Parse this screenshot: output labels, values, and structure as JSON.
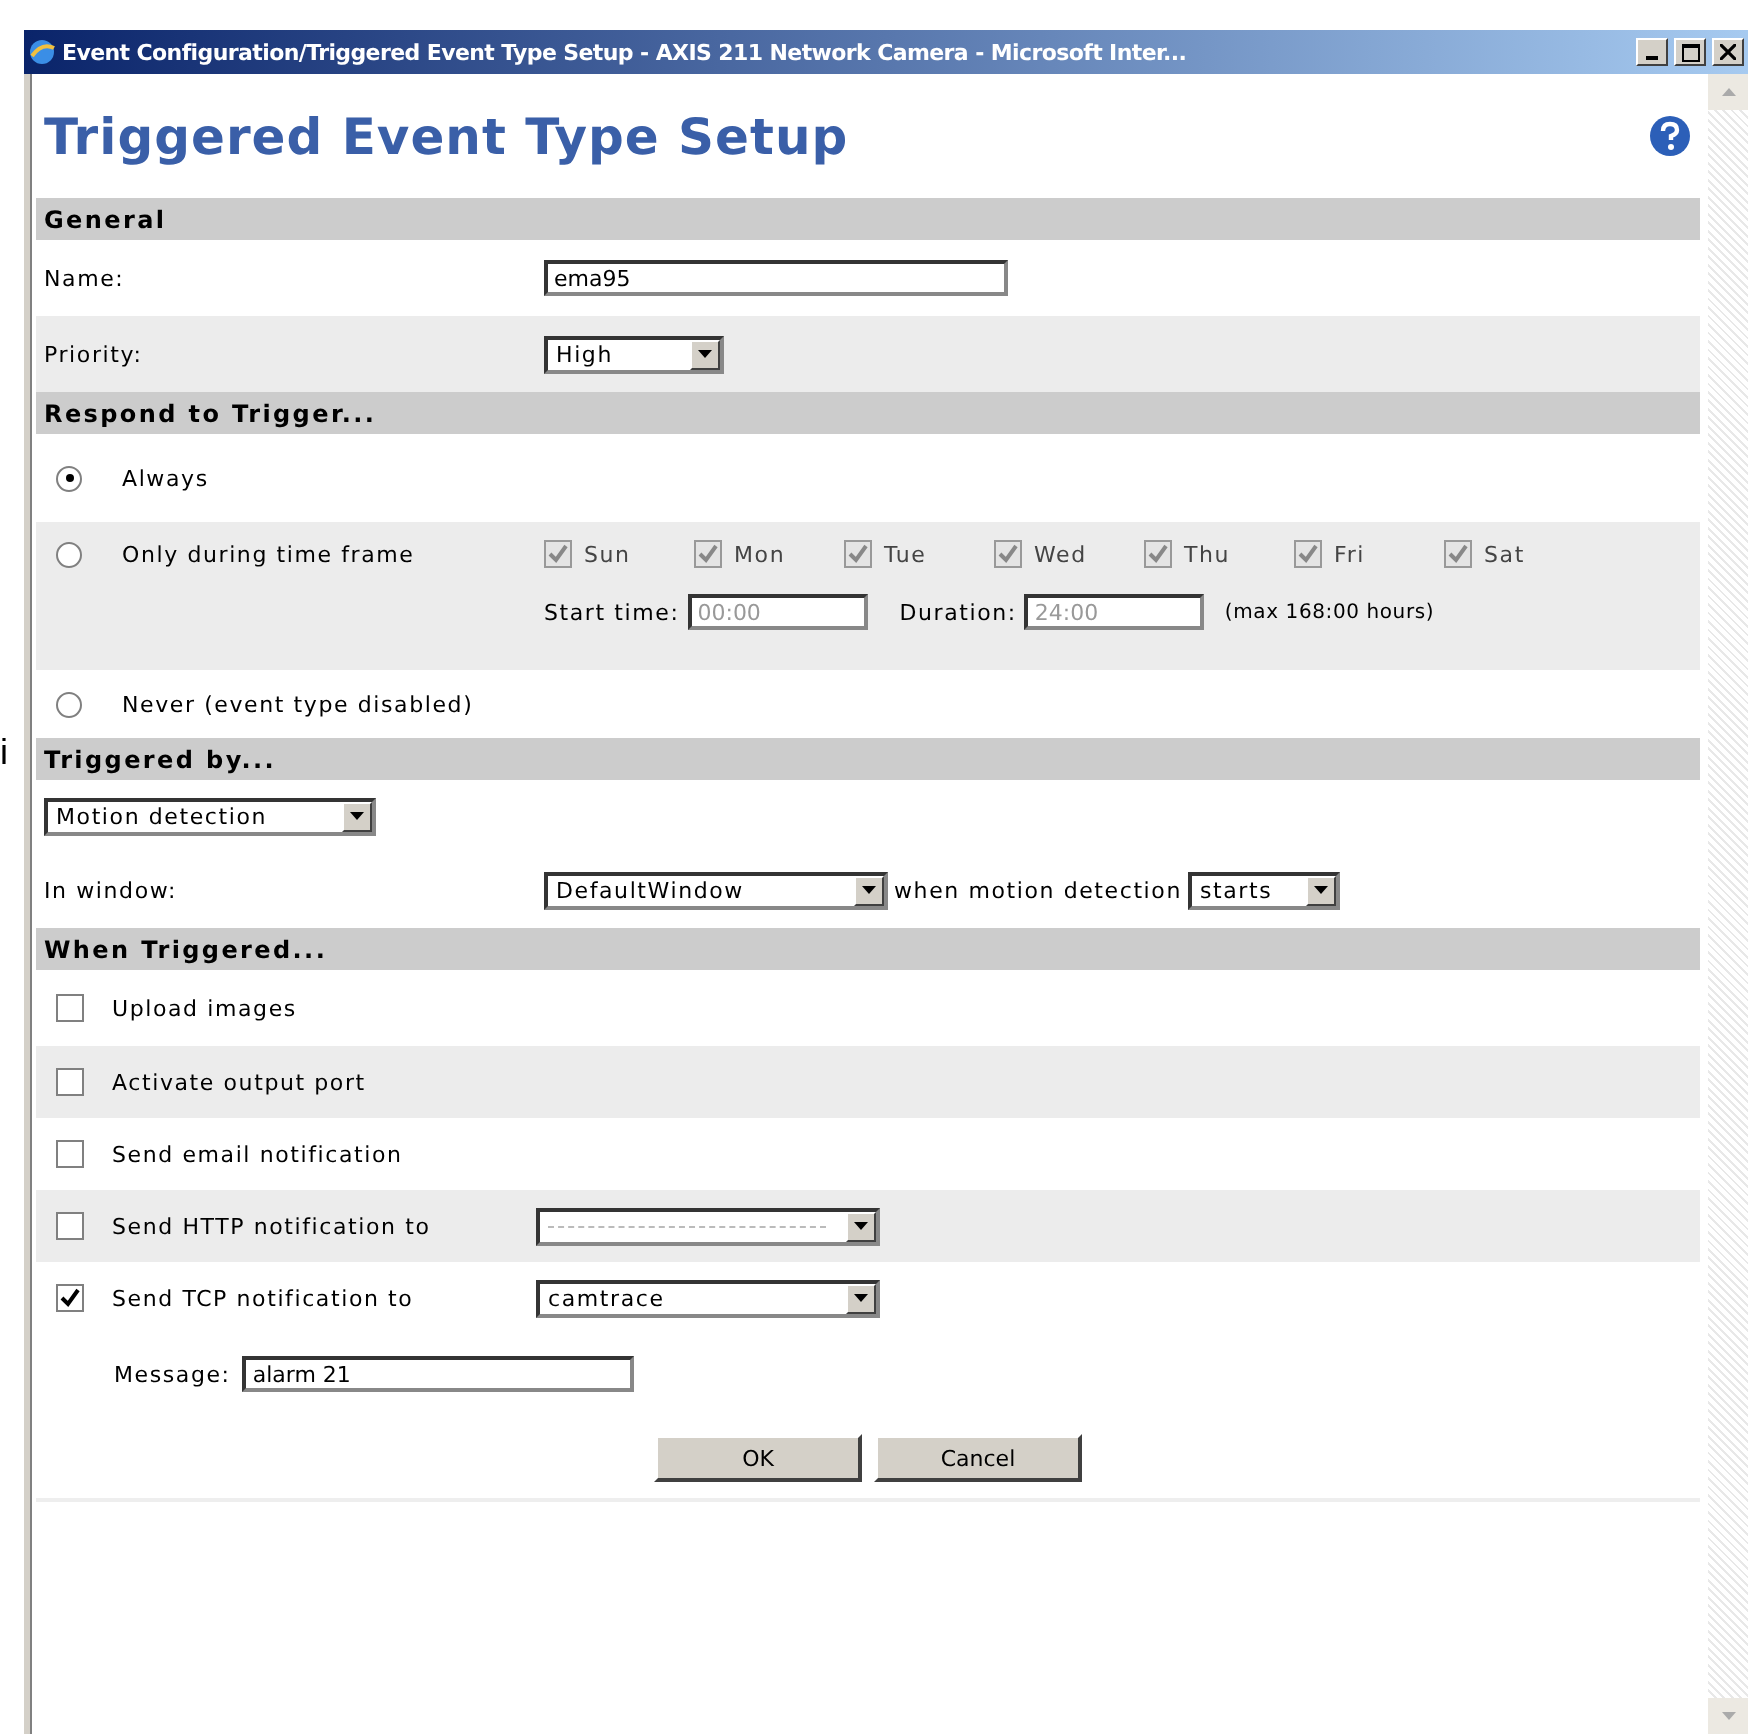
{
  "background_text": "i",
  "window": {
    "title": "Event Configuration/Triggered Event Type Setup - AXIS 211 Network Camera - Microsoft Inter..."
  },
  "page_title": "Triggered Event Type Setup",
  "general": {
    "heading": "General",
    "name_label": "Name:",
    "name_value": "ema95",
    "priority_label": "Priority:",
    "priority_value": "High"
  },
  "respond": {
    "heading": "Respond to Trigger...",
    "options": [
      {
        "label": "Always",
        "selected": true
      },
      {
        "label": "Only during time frame",
        "selected": false
      },
      {
        "label": "Never (event type disabled)",
        "selected": false
      }
    ],
    "days": [
      {
        "label": "Sun",
        "checked": true,
        "disabled": true
      },
      {
        "label": "Mon",
        "checked": true,
        "disabled": true
      },
      {
        "label": "Tue",
        "checked": true,
        "disabled": true
      },
      {
        "label": "Wed",
        "checked": true,
        "disabled": true
      },
      {
        "label": "Thu",
        "checked": true,
        "disabled": true
      },
      {
        "label": "Fri",
        "checked": true,
        "disabled": true
      },
      {
        "label": "Sat",
        "checked": true,
        "disabled": true
      }
    ],
    "start_label": "Start time:",
    "start_value": "00:00",
    "duration_label": "Duration:",
    "duration_value": "24:00",
    "max_note": "(max 168:00 hours)",
    "times_disabled": true
  },
  "triggered_by": {
    "heading": "Triggered by...",
    "source": "Motion detection",
    "window_label": "In window:",
    "window_value": "DefaultWindow",
    "when_label": "when motion detection",
    "when_value": "starts"
  },
  "when_triggered": {
    "heading": "When Triggered...",
    "actions": [
      {
        "label": "Upload images",
        "checked": false,
        "kind": "plain"
      },
      {
        "label": "Activate output port",
        "checked": false,
        "kind": "plain"
      },
      {
        "label": "Send email notification",
        "checked": false,
        "kind": "plain"
      },
      {
        "label": "Send HTTP notification to",
        "checked": false,
        "kind": "select"
      },
      {
        "label": "Send TCP notification to",
        "checked": true,
        "kind": "select",
        "target": "camtrace"
      }
    ],
    "message_label": "Message:",
    "message_value": "alarm 21"
  },
  "buttons": [
    {
      "label": "OK"
    },
    {
      "label": "Cancel"
    }
  ]
}
